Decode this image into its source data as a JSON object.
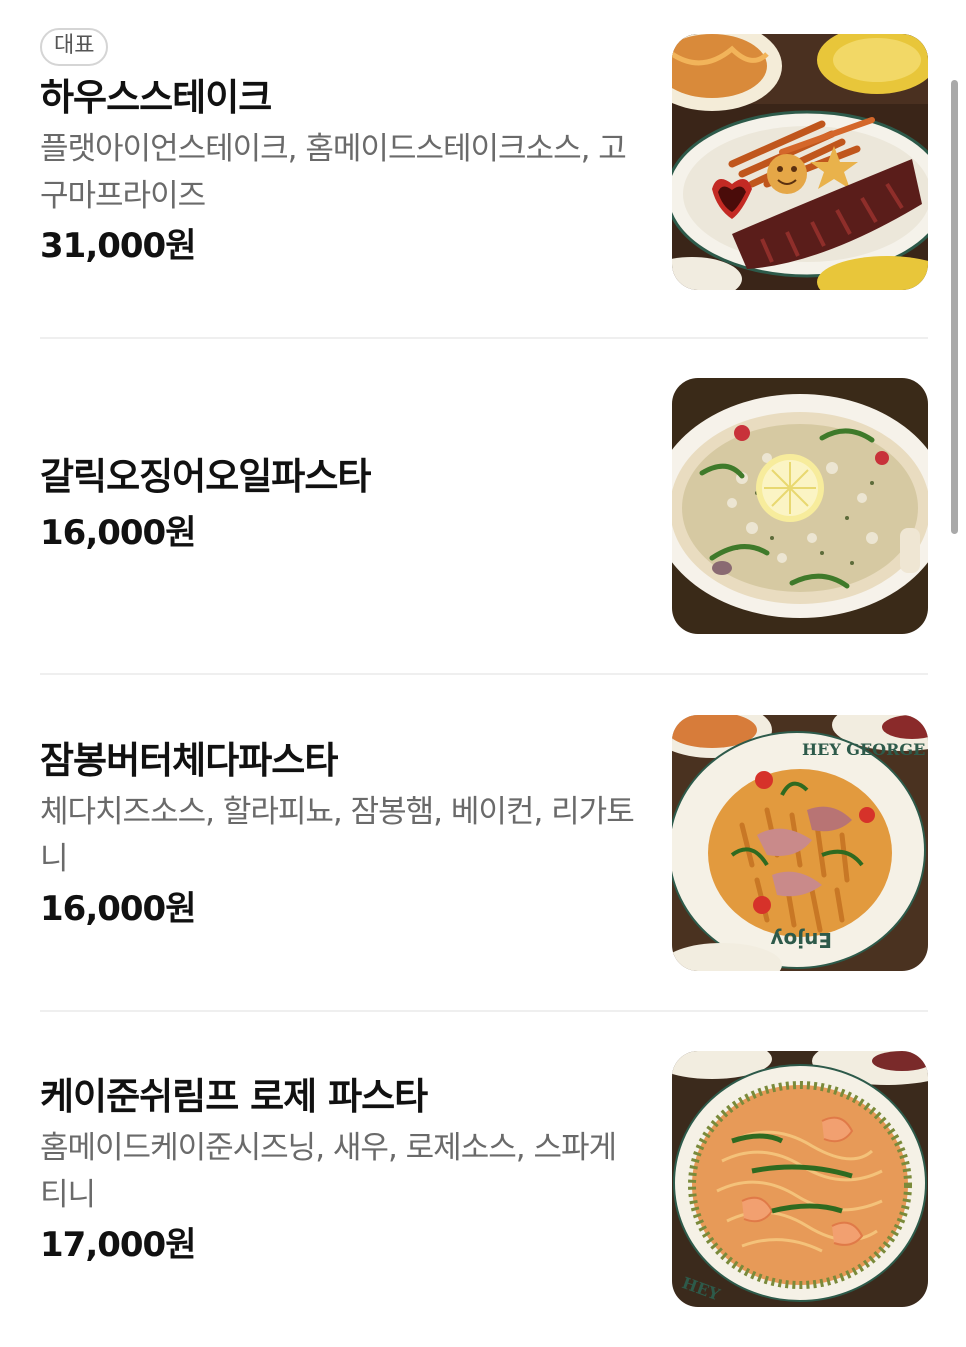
{
  "menu": {
    "items": [
      {
        "badge": "대표",
        "name": "하우스스테이크",
        "description": "플랫아이언스테이크, 홈메이드스테이크소스, 고구마프라이즈",
        "price": "31,000원",
        "image_icon": "steak-photo"
      },
      {
        "name": "갈릭오징어오일파스타",
        "price": "16,000원",
        "image_icon": "garlic-squid-pasta-photo"
      },
      {
        "name": "잠봉버터체다파스타",
        "description": "체다치즈소스, 할라피뇨, 잠봉햄, 베이컨, 리가토니",
        "price": "16,000원",
        "image_icon": "jambon-cheddar-pasta-photo"
      },
      {
        "name": "케이준쉬림프 로제 파스타",
        "description": "홈메이드케이준시즈닝, 새우, 로제소스, 스파게티니",
        "price": "17,000원",
        "image_icon": "cajun-shrimp-rose-pasta-photo"
      }
    ]
  },
  "colors": {
    "text_primary": "#111111",
    "text_secondary": "#6a6a6a",
    "divider": "#efefef",
    "badge_border": "#d5d5d5"
  }
}
